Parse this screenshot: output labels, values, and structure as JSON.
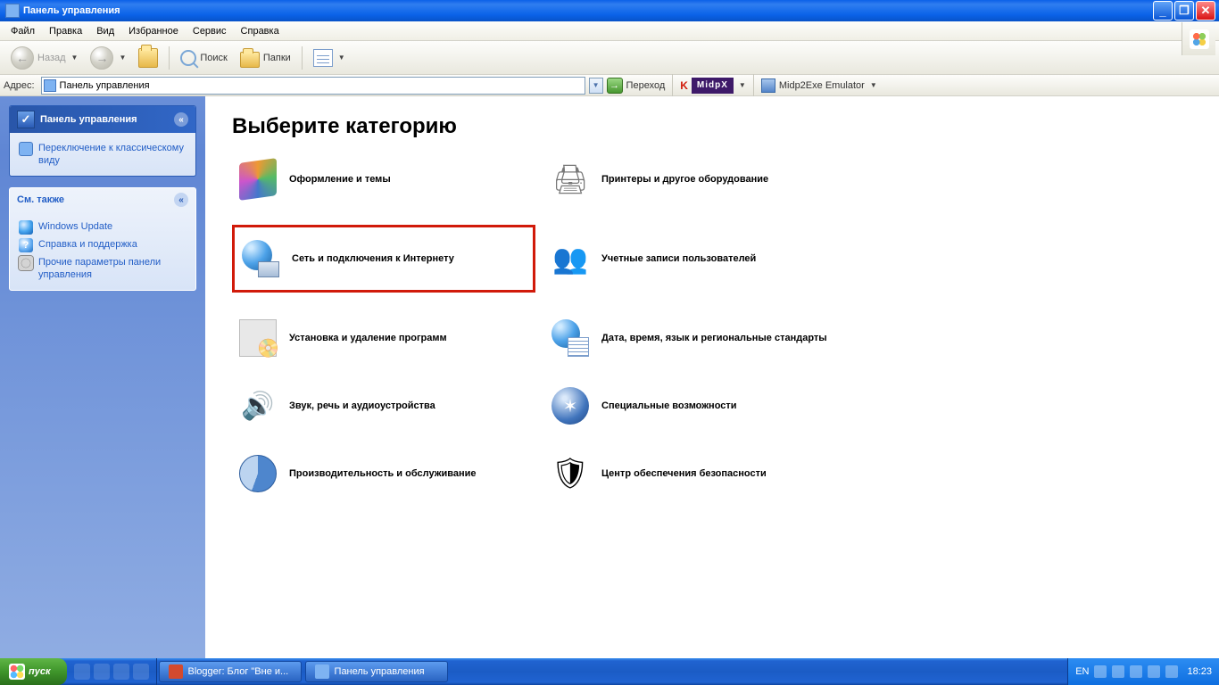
{
  "window": {
    "title": "Панель управления"
  },
  "menus": {
    "file": "Файл",
    "edit": "Правка",
    "view": "Вид",
    "favorites": "Избранное",
    "service": "Сервис",
    "help": "Справка"
  },
  "toolbar": {
    "back": "Назад",
    "search": "Поиск",
    "folders": "Папки"
  },
  "address": {
    "label": "Адрес:",
    "value": "Панель управления",
    "go": "Переход",
    "midpx_label": "MidpX",
    "emulator": "Midp2Exe Emulator"
  },
  "sidebar": {
    "panel_main": {
      "title": "Панель управления",
      "switch_link": "Переключение к классическому виду"
    },
    "panel_see_also": {
      "title": "См. также",
      "items": [
        "Windows Update",
        "Справка и поддержка",
        "Прочие параметры панели управления"
      ]
    }
  },
  "main": {
    "heading": "Выберите категорию",
    "categories": {
      "appearance": "Оформление и темы",
      "network": "Сеть и подключения к Интернету",
      "addremove": "Установка и удаление программ",
      "sound": "Звук, речь и аудиоустройства",
      "perf": "Производительность и обслуживание",
      "printers": "Принтеры и другое оборудование",
      "users": "Учетные записи пользователей",
      "date": "Дата, время, язык и региональные стандарты",
      "access": "Специальные возможности",
      "security": "Центр обеспечения безопасности"
    }
  },
  "taskbar": {
    "start": "пуск",
    "tasks": [
      "Blogger: Блог \"Вне и...",
      "Панель управления"
    ],
    "lang": "EN",
    "clock": "18:23"
  }
}
